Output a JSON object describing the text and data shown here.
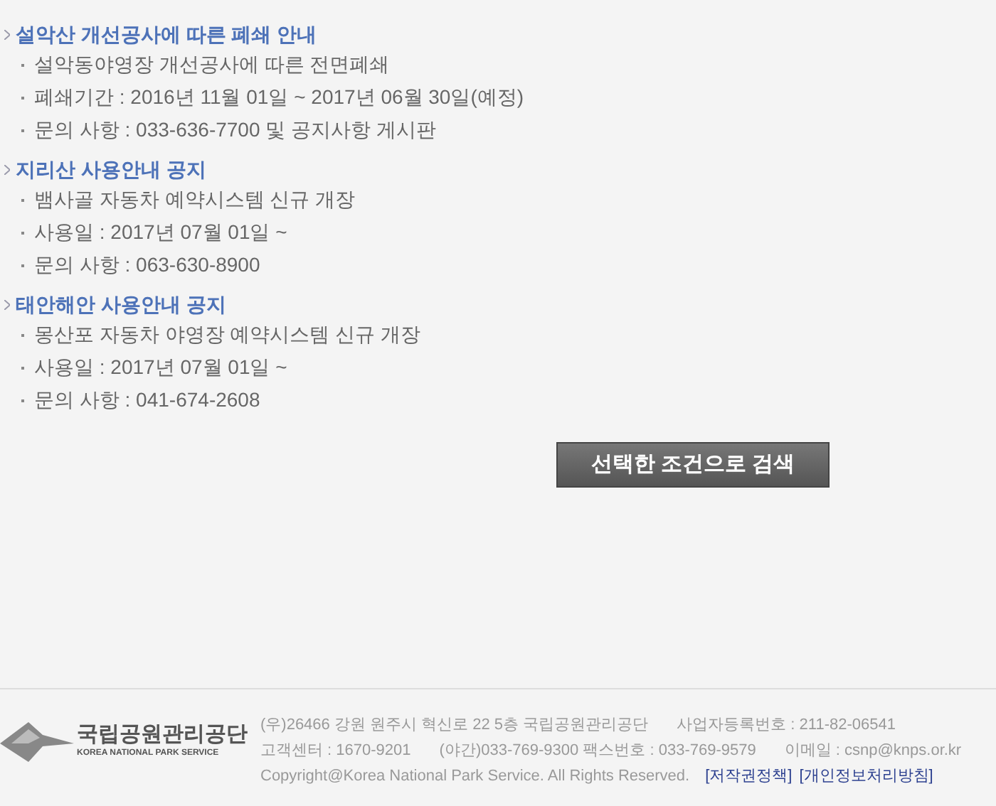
{
  "notices": [
    {
      "title": "설악산 개선공사에 따른 폐쇄 안내",
      "items": [
        "설악동야영장 개선공사에 따른 전면폐쇄",
        "폐쇄기간 : 2016년 11월 01일 ~ 2017년 06월 30일(예정)",
        "문의 사항 : 033-636-7700 및 공지사항 게시판"
      ]
    },
    {
      "title": "지리산 사용안내 공지",
      "items": [
        "뱀사골 자동차 예약시스템 신규 개장",
        "사용일 : 2017년 07월 01일 ~",
        "문의 사항 : 063-630-8900"
      ]
    },
    {
      "title": "태안해안 사용안내 공지",
      "items": [
        "몽산포 자동차 야영장 예약시스템 신규 개장",
        "사용일 : 2017년 07월 01일 ~",
        "문의 사항 : 041-674-2608"
      ]
    }
  ],
  "search_button": "선택한 조건으로 검색",
  "footer": {
    "logo": {
      "name": "국립공원관리공단",
      "subtitle": "KOREA NATIONAL PARK SERVICE"
    },
    "lines": [
      [
        "(우)26466 강원 원주시 혁신로 22 5층 국립공원관리공단",
        "사업자등록번호 : 211-82-06541"
      ],
      [
        "고객센터 : 1670-9201",
        "(야간)033-769-9300 팩스번호 : 033-769-9579",
        "이메일 : csnp@knps.or.kr"
      ]
    ],
    "copyright": "Copyright@Korea National Park Service. All Rights Reserved.",
    "links": [
      "[저작권정책]",
      "[개인정보처리방침]"
    ]
  }
}
